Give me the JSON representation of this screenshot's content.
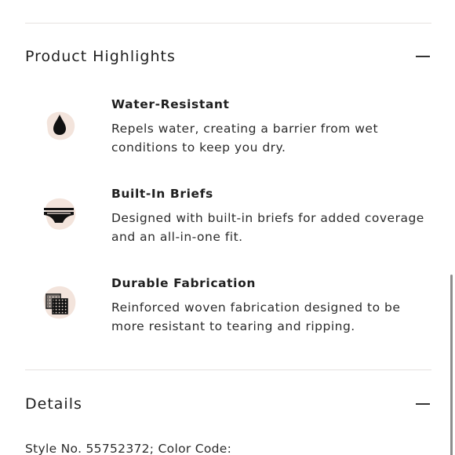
{
  "highlights": {
    "title": "Product Highlights",
    "collapse_icon": "minus-icon",
    "items": [
      {
        "icon": "water-drop-icon",
        "title": "Water-Resistant",
        "description": "Repels water, creating a barrier from wet conditions to keep you dry."
      },
      {
        "icon": "briefs-icon",
        "title": "Built-In Briefs",
        "description": "Designed with built-in briefs for added coverage and an all-in-one fit."
      },
      {
        "icon": "woven-fabric-icon",
        "title": "Durable Fabrication",
        "description": "Reinforced woven fabrication designed to be more resistant to tearing and ripping."
      }
    ]
  },
  "details": {
    "title": "Details",
    "collapse_icon": "minus-icon",
    "style_line": "Style No. 55752372; Color Code:"
  },
  "colors": {
    "icon_blob": "#f3e4dc",
    "divider": "#e6e2e0",
    "text": "#1f1f1f"
  }
}
